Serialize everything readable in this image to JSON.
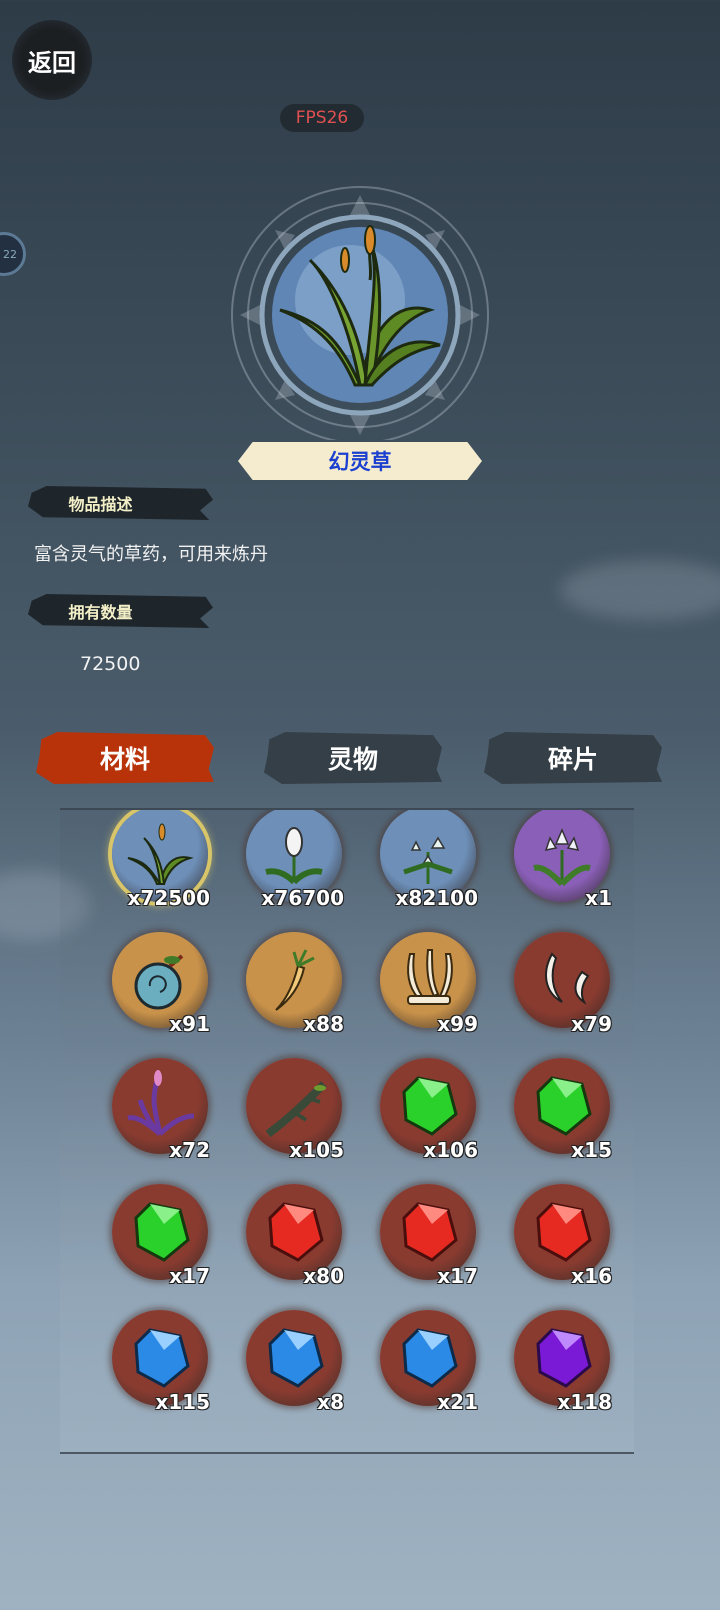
{
  "header": {
    "back_label": "返回",
    "fps_label": "FPS26",
    "side_badge": "22"
  },
  "item": {
    "name": "幻灵草",
    "desc_heading": "物品描述",
    "description": "富含灵气的草药，可用来炼丹",
    "count_heading": "拥有数量",
    "count": "72500"
  },
  "tabs": [
    {
      "label": "材料",
      "active": true
    },
    {
      "label": "灵物",
      "active": false
    },
    {
      "label": "碎片",
      "active": false
    }
  ],
  "grid": [
    {
      "icon": "grass-herb-icon",
      "qty": "x72500",
      "bg": "#6d8fb8",
      "selected": true
    },
    {
      "icon": "white-flower-icon",
      "qty": "x76700",
      "bg": "#6d8fb8"
    },
    {
      "icon": "star-flower-icon",
      "qty": "x82100",
      "bg": "#6d8fb8"
    },
    {
      "icon": "purple-lily-icon",
      "qty": "x1",
      "bg": "#8a5fb8"
    },
    {
      "icon": "spirit-fruit-icon",
      "qty": "x91",
      "bg": "#c9924a"
    },
    {
      "icon": "ginseng-root-icon",
      "qty": "x88",
      "bg": "#c9924a"
    },
    {
      "icon": "bone-claws-icon",
      "qty": "x99",
      "bg": "#c9924a"
    },
    {
      "icon": "beast-fangs-icon",
      "qty": "x79",
      "bg": "#8a3b30"
    },
    {
      "icon": "purple-herb-icon",
      "qty": "x72",
      "bg": "#8a3b30"
    },
    {
      "icon": "branch-icon",
      "qty": "x105",
      "bg": "#8a3b30"
    },
    {
      "icon": "green-gem-icon",
      "qty": "x106",
      "bg": "#8a3b30"
    },
    {
      "icon": "green-gem-icon",
      "qty": "x15",
      "bg": "#8a3b30"
    },
    {
      "icon": "green-gem-icon",
      "qty": "x17",
      "bg": "#8a3b30"
    },
    {
      "icon": "red-gem-icon",
      "qty": "x80",
      "bg": "#8a3b30"
    },
    {
      "icon": "red-gem-icon",
      "qty": "x17",
      "bg": "#8a3b30"
    },
    {
      "icon": "red-gem-icon",
      "qty": "x16",
      "bg": "#8a3b30"
    },
    {
      "icon": "blue-gem-icon",
      "qty": "x115",
      "bg": "#8a3b30"
    },
    {
      "icon": "blue-gem-icon",
      "qty": "x8",
      "bg": "#8a3b30"
    },
    {
      "icon": "blue-gem-icon",
      "qty": "x21",
      "bg": "#8a3b30"
    },
    {
      "icon": "purple-gem-icon",
      "qty": "x118",
      "bg": "#8a3b30"
    }
  ],
  "colors": {
    "tab_active": "#b8330a",
    "tab_inactive": "#353f47",
    "item_name": "#1b3fcf",
    "fps": "#e05050"
  }
}
